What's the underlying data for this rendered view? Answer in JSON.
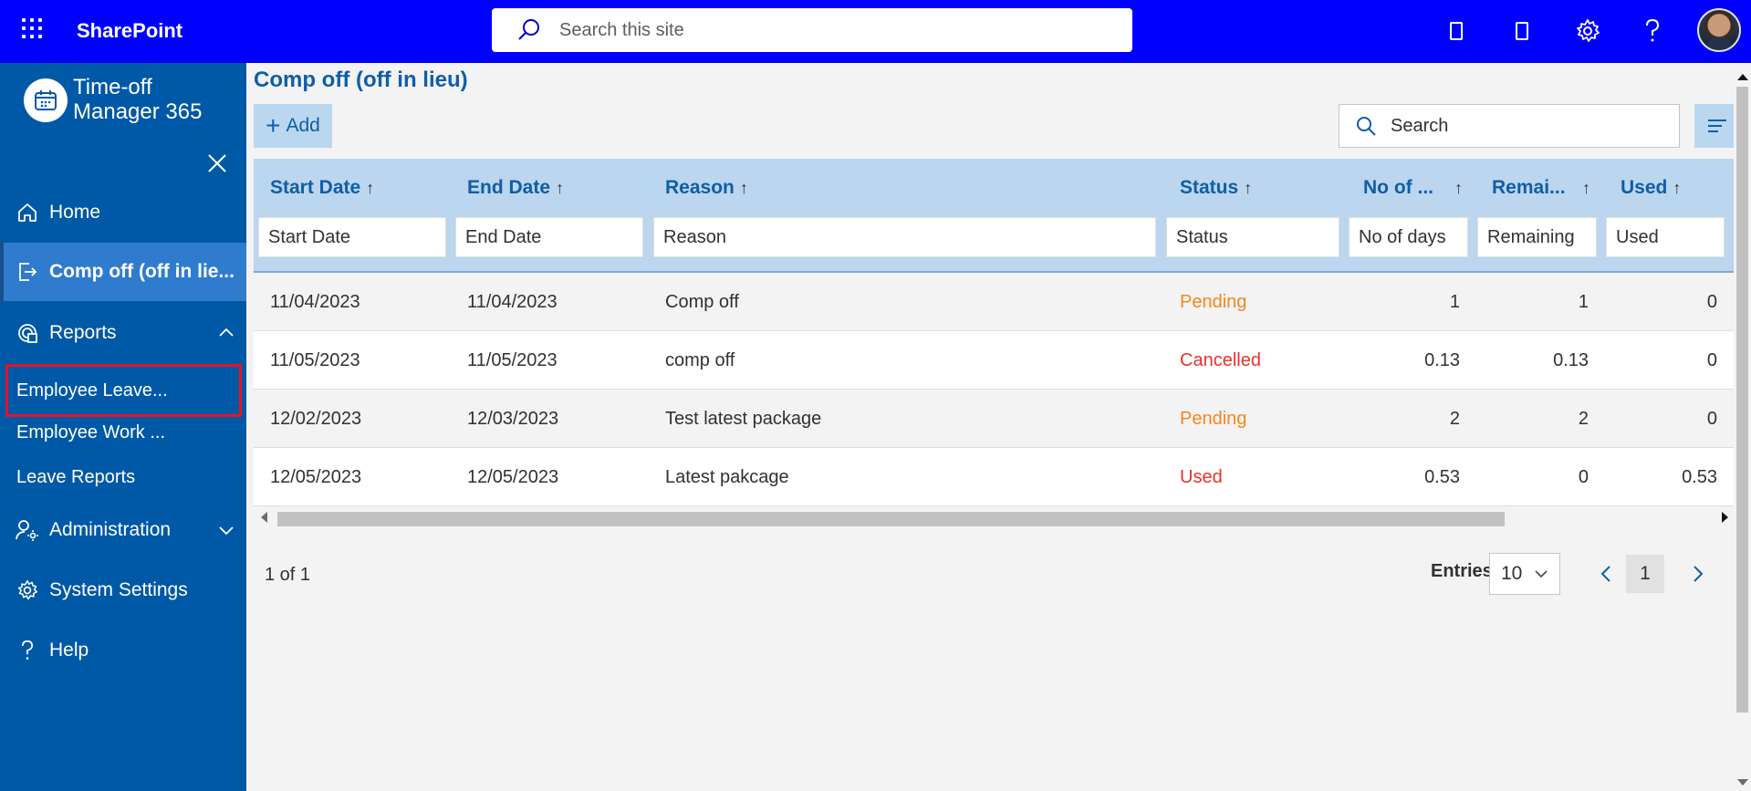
{
  "suitebar": {
    "brand": "SharePoint",
    "search_placeholder": "Search this site",
    "icons": [
      "waffle-icon",
      "search-icon",
      "tablet-icon",
      "tablet-icon",
      "gear-icon",
      "help-icon",
      "avatar"
    ]
  },
  "nav": {
    "app_title": "Time-off Manager 365",
    "items": [
      {
        "label": "Home",
        "icon": "home-icon"
      },
      {
        "label": "Comp off (off in lie...",
        "icon": "signout-icon",
        "active": true
      },
      {
        "label": "Reports",
        "icon": "reports-icon",
        "expanded": true
      },
      {
        "label": "Administration",
        "icon": "admin-icon",
        "expanded": false
      },
      {
        "label": "System Settings",
        "icon": "gear-icon"
      },
      {
        "label": "Help",
        "icon": "help-icon"
      }
    ],
    "report_subitems": [
      "Employee Leave...",
      "Employee Work ...",
      "Leave Reports"
    ]
  },
  "main": {
    "title": "Comp off (off in lieu)",
    "add_label": "Add",
    "search_placeholder": "Search",
    "columns": [
      "Start Date",
      "End Date",
      "Reason",
      "Status",
      "No of ...",
      "Remai...",
      "Used"
    ],
    "sort_arrow": "↑",
    "filters": [
      "Start Date",
      "End Date",
      "Reason",
      "Status",
      "No of days",
      "Remaining",
      "Used"
    ],
    "rows": [
      {
        "start": "11/04/2023",
        "end": "11/04/2023",
        "reason": "Comp off",
        "status": "Pending",
        "days": "1",
        "remaining": "1",
        "used": "0"
      },
      {
        "start": "11/05/2023",
        "end": "11/05/2023",
        "reason": "comp off",
        "status": "Cancelled",
        "days": "0.13",
        "remaining": "0.13",
        "used": "0"
      },
      {
        "start": "12/02/2023",
        "end": "12/03/2023",
        "reason": "Test latest package",
        "status": "Pending",
        "days": "2",
        "remaining": "2",
        "used": "0"
      },
      {
        "start": "12/05/2023",
        "end": "12/05/2023",
        "reason": "Latest pakcage",
        "status": "Used",
        "days": "0.53",
        "remaining": "0",
        "used": "0.53"
      }
    ],
    "pager": {
      "info": "1 of 1",
      "entries_label": "Entries",
      "entries_value": "10",
      "page": "1"
    }
  },
  "colors": {
    "suitebar": "#0000ff",
    "nav": "#0059a6",
    "nav_active": "#2f7ccf",
    "header": "#bbd6ee",
    "accent": "#0f5ea8",
    "pending": "#f7851d",
    "cancelled": "#e8312b",
    "highlight": "#e81123"
  }
}
